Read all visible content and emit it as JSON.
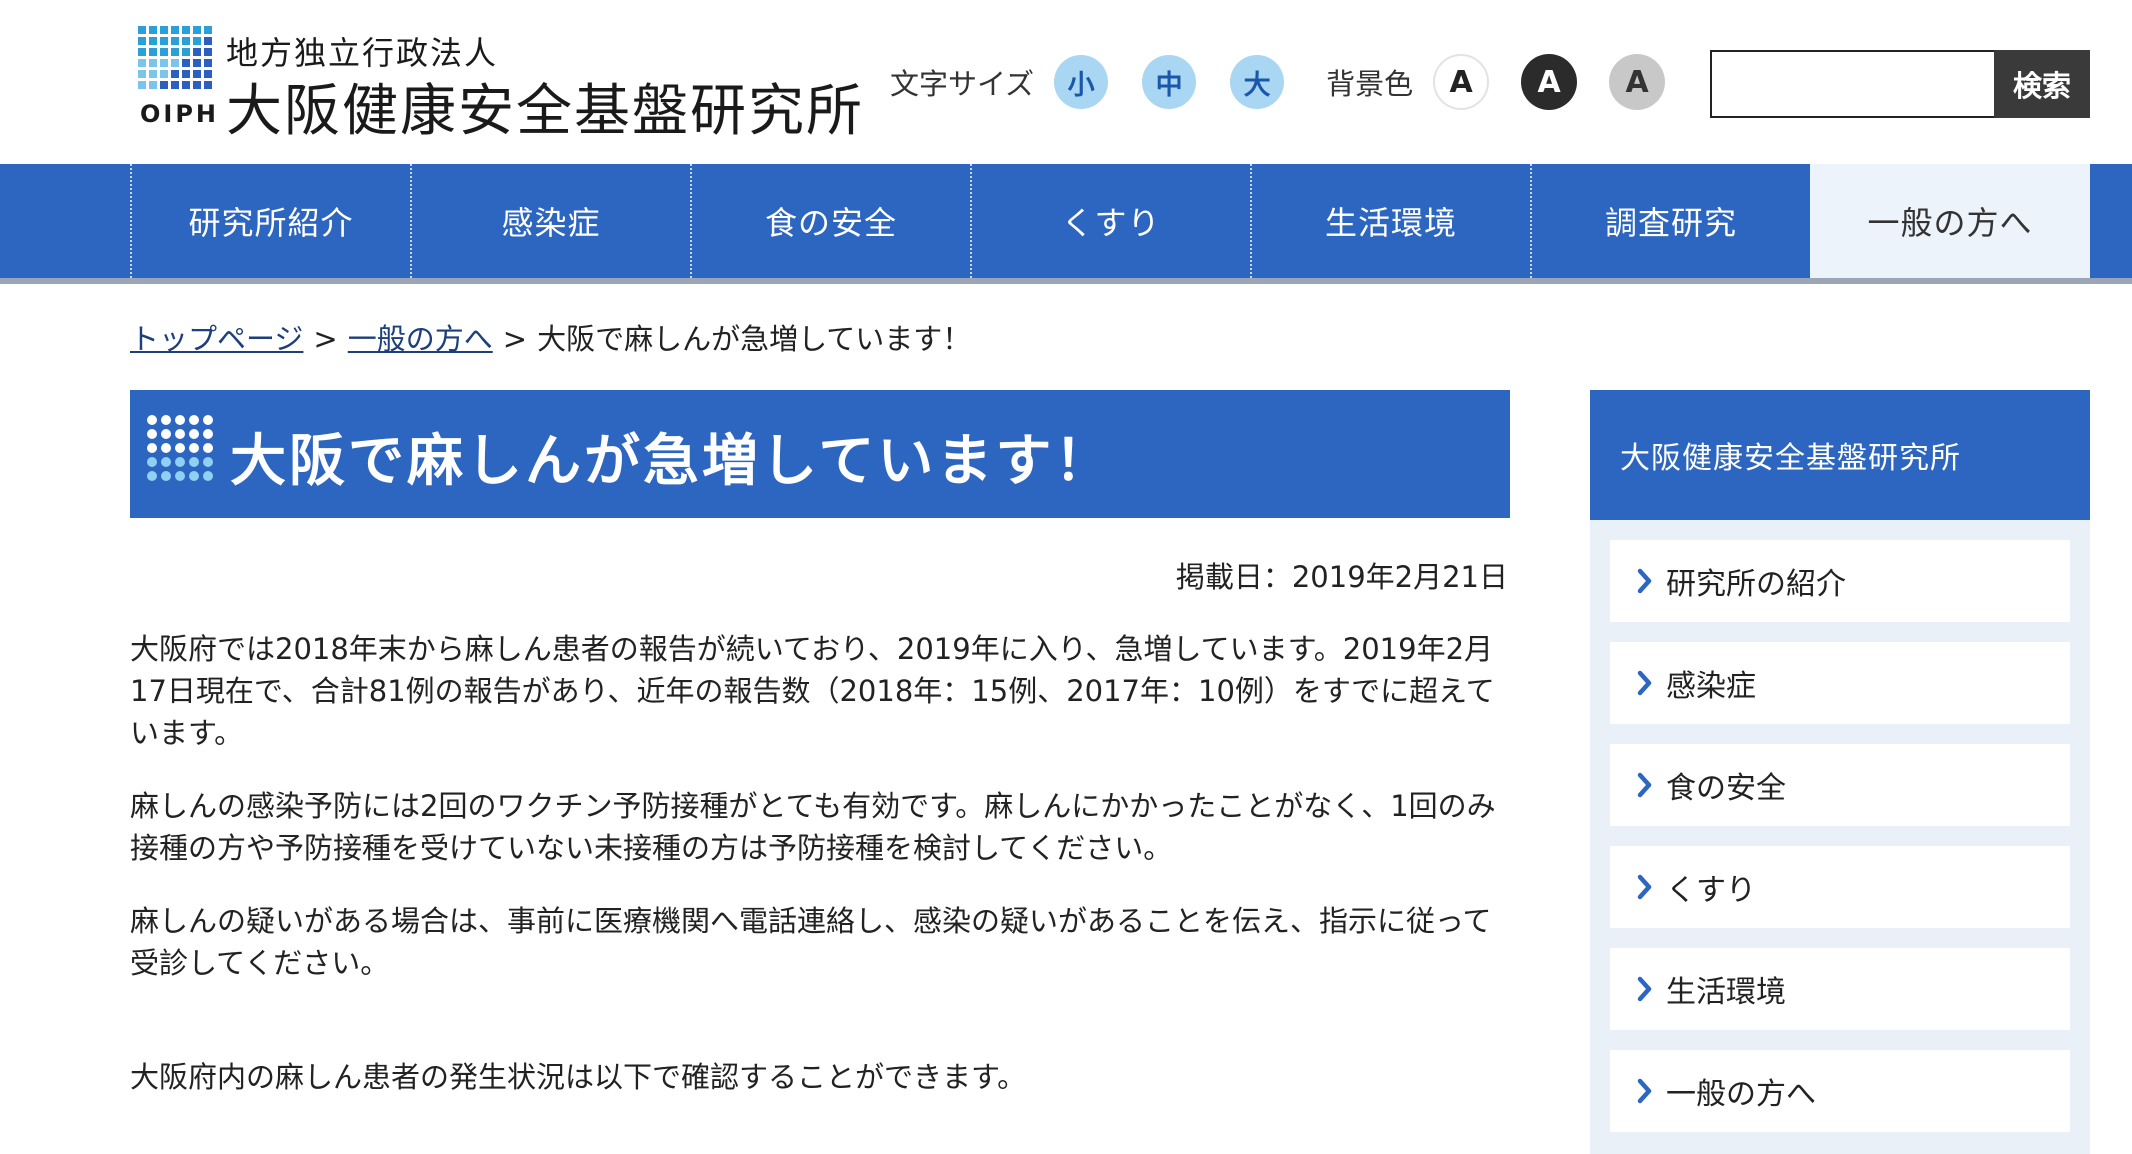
{
  "header": {
    "logo_sub": "地方独立行政法人",
    "logo_main": "大阪健康安全基盤研究所",
    "logo_abbr": "OIPH",
    "font_size_label": "文字サイズ",
    "font_sizes": [
      "小",
      "中",
      "大"
    ],
    "bg_color_label": "背景色",
    "bg_options": [
      "A",
      "A",
      "A"
    ],
    "search_placeholder": "",
    "search_button": "検索"
  },
  "nav": {
    "items": [
      "研究所紹介",
      "感染症",
      "食の安全",
      "くすり",
      "生活環境",
      "調査研究",
      "一般の方へ"
    ],
    "active_index": 6
  },
  "breadcrumb": {
    "home": "トップページ",
    "parent": "一般の方へ",
    "current": "大阪で麻しんが急増しています！",
    "separator": ">"
  },
  "article": {
    "title": "大阪で麻しんが急増しています！",
    "date": "掲載日：2019年2月21日",
    "paragraphs": [
      "大阪府では2018年末から麻しん患者の報告が続いており、2019年に入り、急増しています。2019年2月17日現在で、合計81例の報告があり、近年の報告数（2018年：15例、2017年：10例）をすでに超えています。",
      "麻しんの感染予防には2回のワクチン予防接種がとても有効です。麻しんにかかったことがなく、1回のみ接種の方や予防接種を受けていない未接種の方は予防接種を検討してください。",
      "麻しんの疑いがある場合は、事前に医療機関へ電話連絡し、感染の疑いがあることを伝え、指示に従って受診してください。",
      "大阪府内の麻しん患者の発生状況は以下で確認することができます。"
    ]
  },
  "sidebar": {
    "heading": "大阪健康安全基盤研究所",
    "items": [
      "研究所の紹介",
      "感染症",
      "食の安全",
      "くすり",
      "生活環境",
      "一般の方へ"
    ]
  },
  "colors": {
    "brand_blue": "#2d66c1",
    "size_button_bg": "#a9d6f2",
    "nav_active_bg": "#edf3fb",
    "sidebar_bg": "#e9f0f8"
  }
}
